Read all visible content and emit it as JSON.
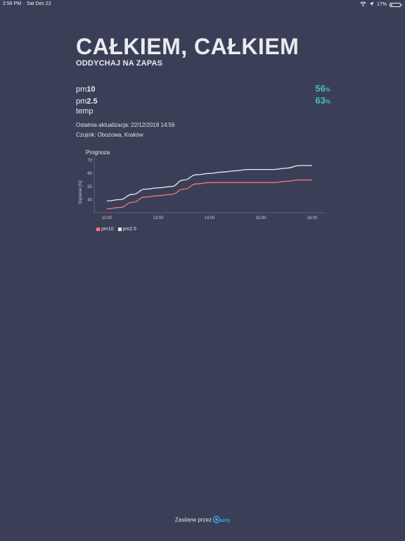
{
  "status_bar": {
    "time": "2:56 PM",
    "date": "Sat Dec 22",
    "battery": "17%",
    "battery_level": 0.17,
    "icons": [
      "wifi-icon",
      "location-arrow-icon",
      "battery-icon"
    ]
  },
  "header": {
    "title": "CAŁKIEM, CAŁKIEM",
    "subtitle": "ODDYCHAJ NA ZAPAS"
  },
  "metrics": [
    {
      "label_prefix": "pm",
      "label_strong": "10",
      "value": "56",
      "unit": "%"
    },
    {
      "label_prefix": "pm",
      "label_strong": "2.5",
      "value": "63",
      "unit": "%"
    },
    {
      "label_prefix": "temp",
      "label_strong": "",
      "value": "",
      "unit": ""
    }
  ],
  "meta": {
    "updated": "Ostatnia aktualizacja: 22/12/2018 14:56",
    "sensor": "Czujnik: Obozowa, Kraków"
  },
  "colors": {
    "background": "#3a3f57",
    "accent": "#3fc3b3",
    "pm10": "#f47a72",
    "pm25": "#e9ebf0"
  },
  "chart_data": {
    "type": "line",
    "title": "Prognoza",
    "ylabel": "Stężenie [%]",
    "xlabel": "",
    "x": [
      "12:00",
      "12:15",
      "12:30",
      "12:45",
      "13:00",
      "13:15",
      "13:30",
      "13:45",
      "14:00",
      "14:15",
      "14:30",
      "14:45",
      "15:00",
      "15:15",
      "15:30",
      "15:45",
      "16:00"
    ],
    "xticks": [
      "12:00",
      "13:00",
      "14:00",
      "15:00",
      "16:00"
    ],
    "yticks": [
      40,
      50,
      60,
      70
    ],
    "ylim": [
      30,
      73
    ],
    "grid": false,
    "legend": "bottom-left",
    "series": [
      {
        "name": "pm10",
        "color": "#f47a72",
        "values": [
          33,
          34,
          38,
          42,
          43,
          44,
          48,
          52,
          53,
          53,
          53,
          53,
          53,
          53,
          54,
          55,
          55
        ]
      },
      {
        "name": "pm2.5",
        "color": "#e9ebf0",
        "values": [
          39,
          40,
          44,
          48,
          49,
          50,
          55,
          59,
          60,
          61,
          62,
          63,
          63,
          63,
          64,
          66,
          66
        ]
      }
    ]
  },
  "footer": {
    "powered_by": "Zasilane przez",
    "brand": "airly"
  }
}
